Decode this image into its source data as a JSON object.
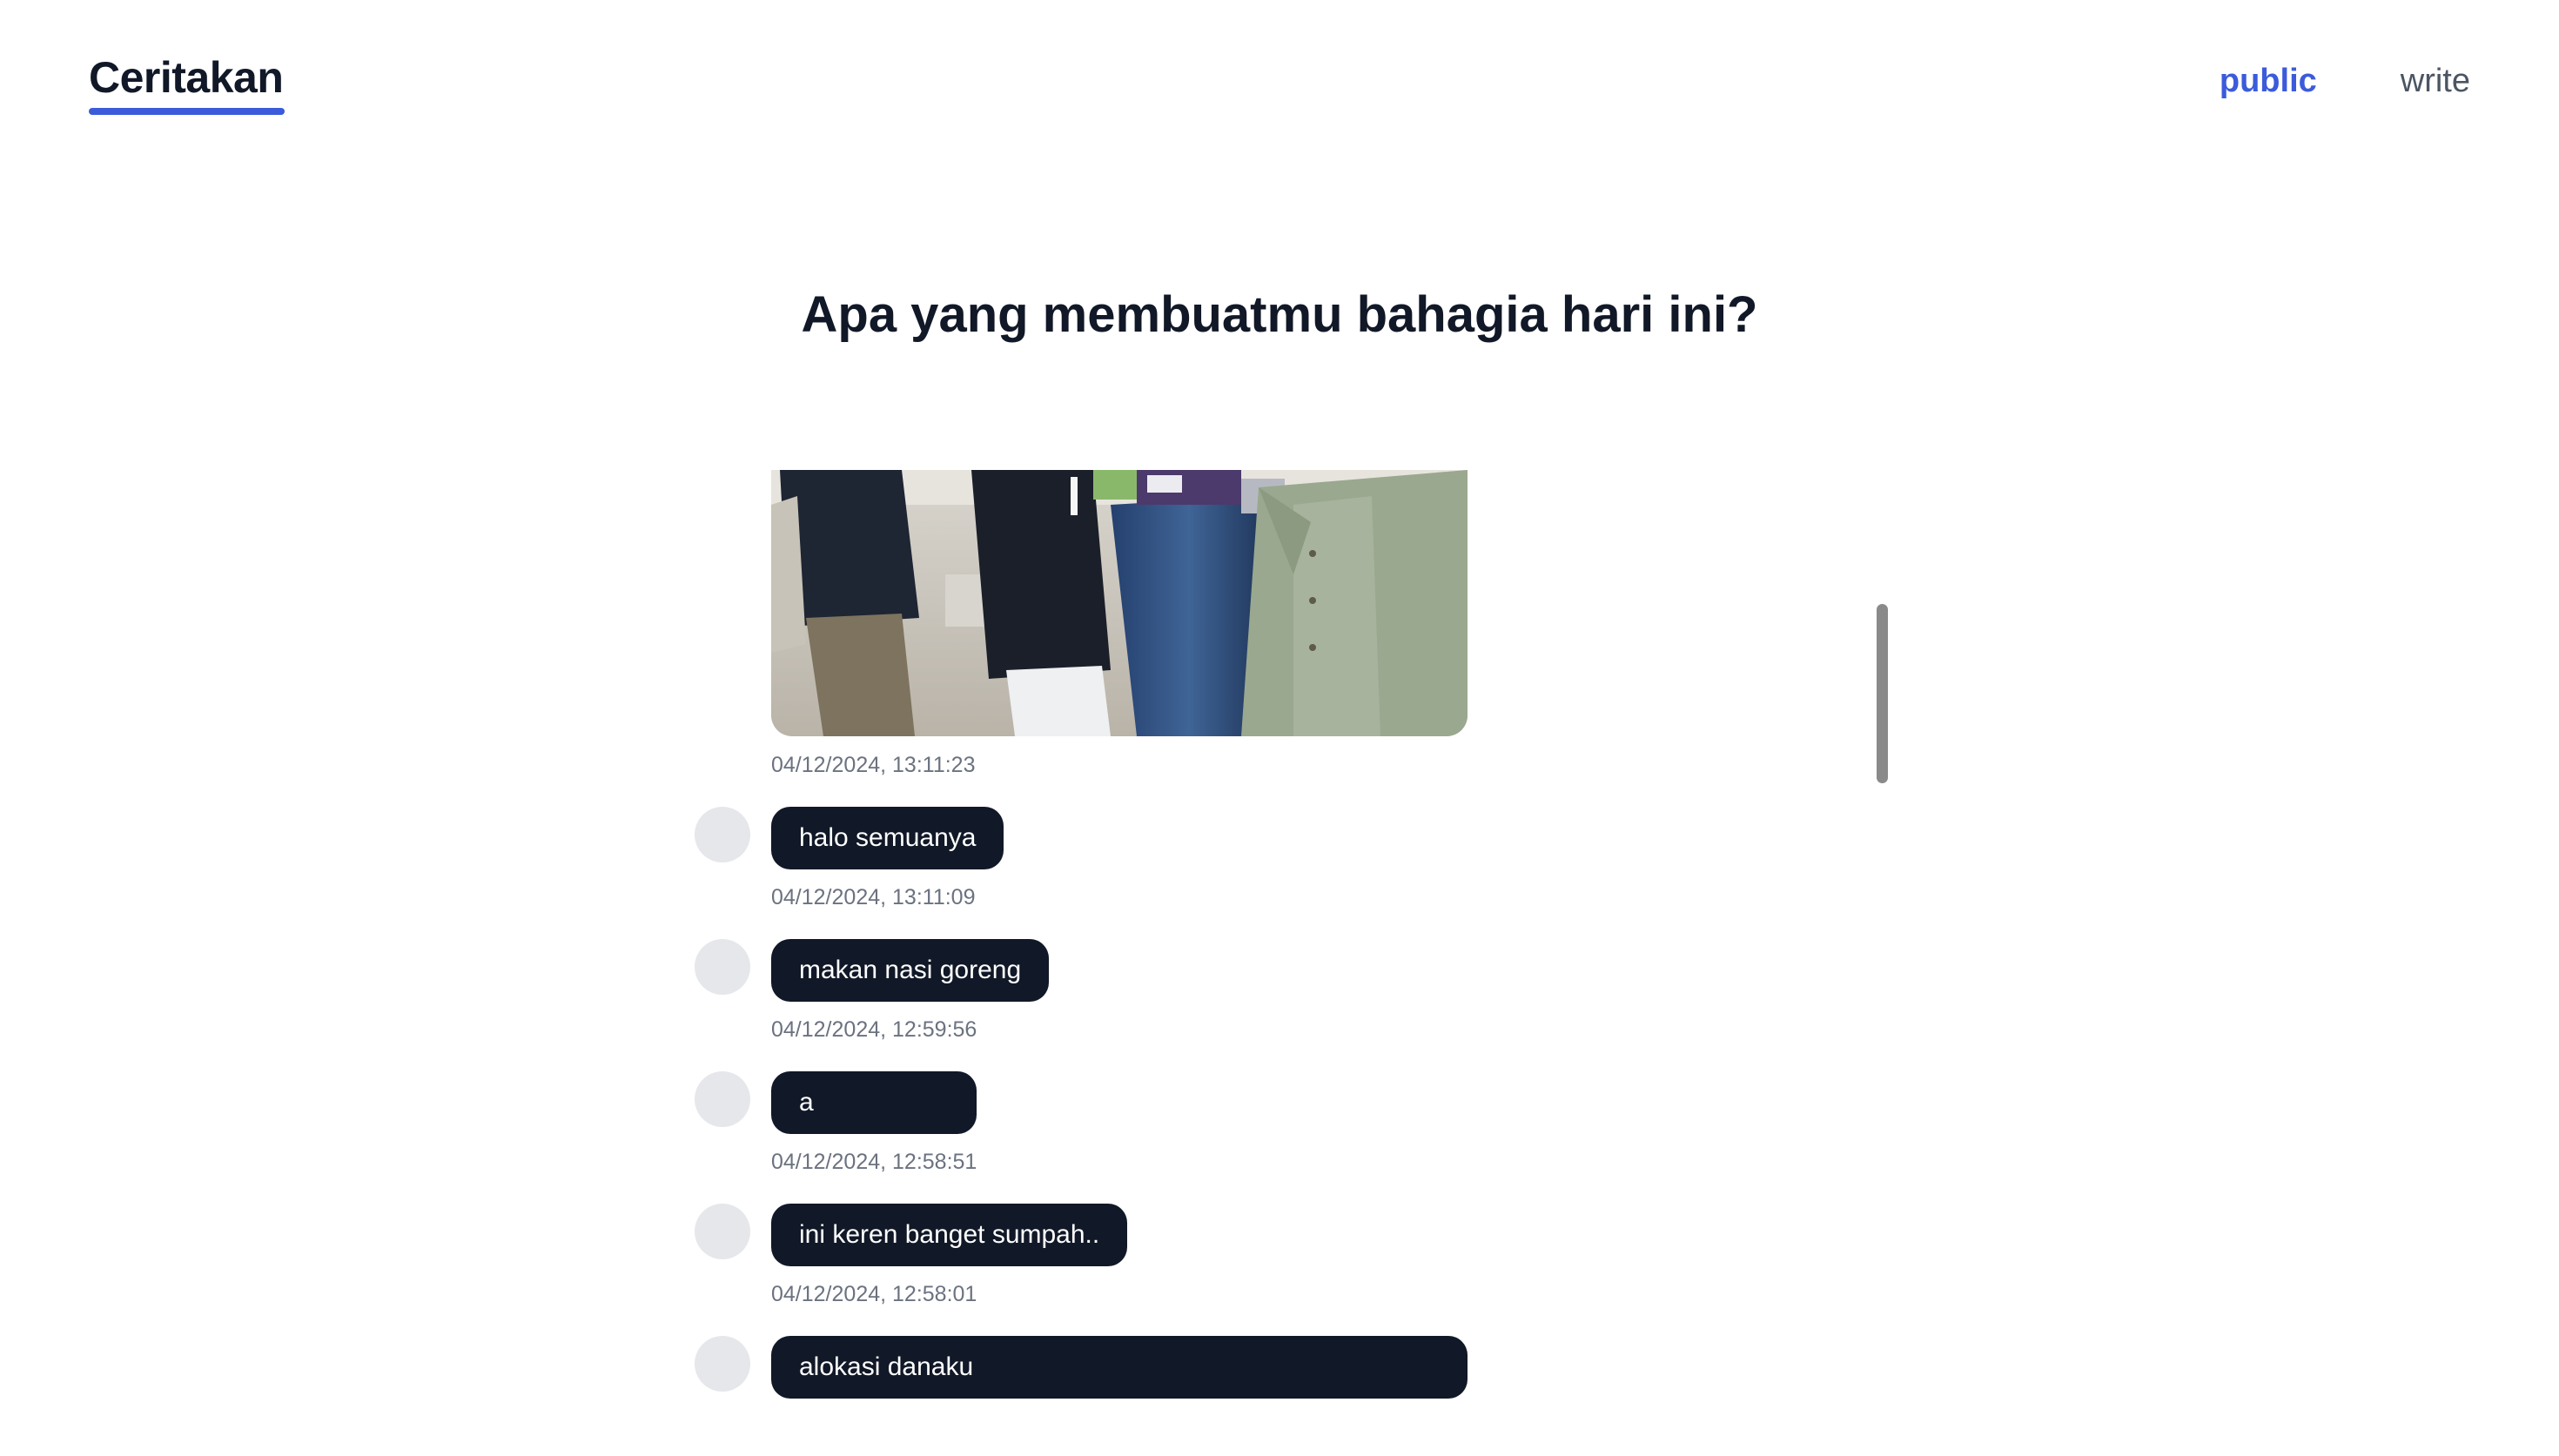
{
  "header": {
    "brand": "Ceritakan",
    "nav": [
      {
        "label": "public",
        "active": true
      },
      {
        "label": "write",
        "active": false
      }
    ]
  },
  "headline": {
    "before": "Apa yang membuatmu ",
    "emphasis": "bahagia",
    "after": " hari ini?"
  },
  "feed": {
    "photo_timestamp": "04/12/2024, 13:11:23",
    "posts": [
      {
        "text": "halo semuanya",
        "timestamp": "04/12/2024, 13:11:09"
      },
      {
        "text": "makan nasi goreng",
        "timestamp": "04/12/2024, 12:59:56"
      },
      {
        "text": "a",
        "timestamp": "04/12/2024, 12:58:51"
      },
      {
        "text": "ini keren banget sumpah..",
        "timestamp": "04/12/2024, 12:58:01"
      },
      {
        "text": "alokasi danaku"
      }
    ]
  },
  "colors": {
    "accent": "#3b5bdb",
    "bubble": "#111827",
    "avatar": "#e5e7eb",
    "timestamp": "#6b7280"
  }
}
